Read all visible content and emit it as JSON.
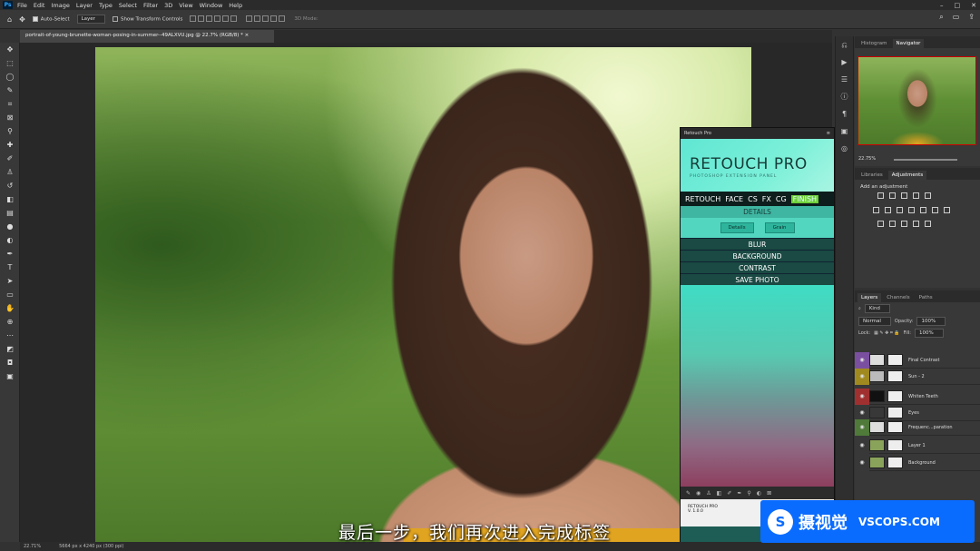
{
  "app": {
    "logo": "Ps"
  },
  "menu": [
    "File",
    "Edit",
    "Image",
    "Layer",
    "Type",
    "Select",
    "Filter",
    "3D",
    "View",
    "Window",
    "Help"
  ],
  "options": {
    "auto_select": "Auto-Select",
    "auto_select_target": "Layer",
    "show_transform": "Show Transform Controls",
    "mode_3d": "3D Mode:"
  },
  "document": {
    "tab_title": "portrait-of-young-brunette-woman-posing-in-summer--49ALXVU.jpg @ 22.7% (RGB/8) *"
  },
  "retouch_panel": {
    "header": "Retouch Pro",
    "brand": "RETOUCH PRO",
    "brand_sub": "PHOTOSHOP EXTENSION PANEL",
    "tabs": [
      "RETOUCH",
      "FACE",
      "CS",
      "FX",
      "CG",
      "FINISH"
    ],
    "active_tab": "FINISH",
    "sections": {
      "details": "DETAILS",
      "blur": "BLUR",
      "background": "BACKGROUND",
      "contrast": "CONTRAST",
      "save": "SAVE PHOTO"
    },
    "buttons": {
      "details": "Details",
      "grain": "Grain"
    },
    "footer_name": "RETOUCH PRO",
    "footer_version": "V. 1.0.0"
  },
  "navigator": {
    "tabs": [
      "Histogram",
      "Navigator"
    ],
    "active": "Navigator",
    "zoom": "22.75%"
  },
  "adjustments": {
    "tabs": [
      "Libraries",
      "Adjustments"
    ],
    "active": "Adjustments",
    "title": "Add an adjustment"
  },
  "layers_panel": {
    "tabs": [
      "Layers",
      "Channels",
      "Paths"
    ],
    "active": "Layers",
    "kind": "Kind",
    "blend": "Normal",
    "opacity_label": "Opacity:",
    "opacity": "100%",
    "lock_label": "Lock:",
    "fill_label": "Fill:",
    "fill": "100%",
    "layers": [
      {
        "name": "Final Contrast",
        "color": "#7a4fa0",
        "thumb": "#ddd"
      },
      {
        "name": "Sun - 2",
        "color": "#a08a20",
        "thumb": "#bbb"
      },
      {
        "name": "Whiten Teeth",
        "color": "#a03030",
        "thumb": "#111"
      },
      {
        "name": "Eyes",
        "color": "#383838",
        "thumb": "#383838"
      },
      {
        "name": "Frequenc...paration",
        "color": "#4f7a3a",
        "thumb": "#ddd"
      },
      {
        "name": "Layer 1",
        "color": "#383838",
        "thumb": "#8aa35a"
      },
      {
        "name": "Background",
        "color": "#383838",
        "thumb": "#8aa35a"
      }
    ]
  },
  "status": {
    "zoom": "22.71%",
    "dimensions": "5664 px x 4240 px (300 ppi)"
  },
  "subtitle": "最后一步，我们再次进入完成标签",
  "watermark": {
    "logo": "S",
    "cn": "摄视觉",
    "en": "VSCOPS.COM"
  }
}
